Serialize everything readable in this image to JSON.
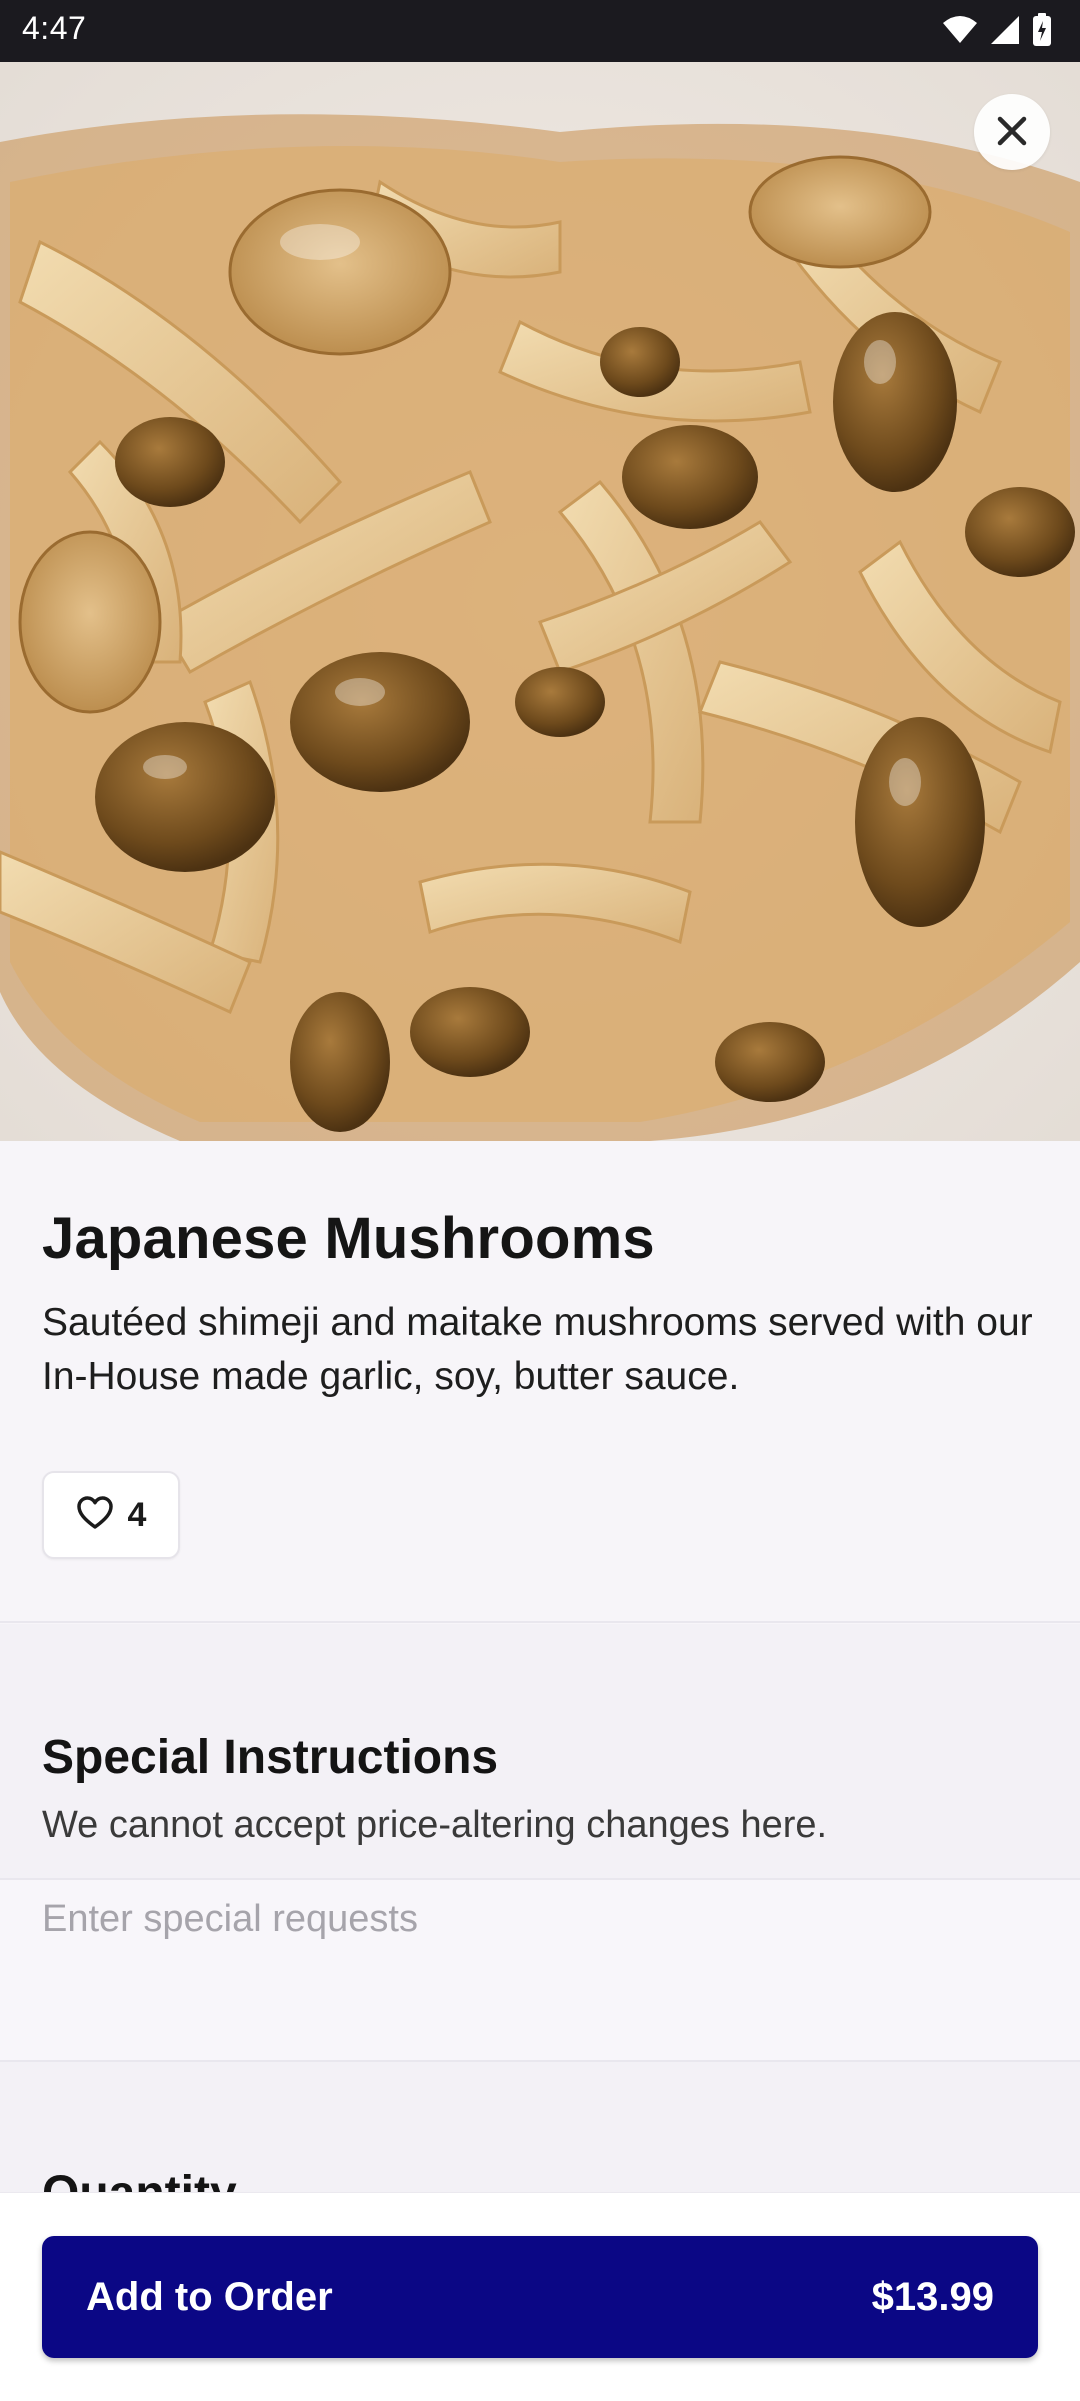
{
  "status_bar": {
    "time": "4:47",
    "icons": [
      "wifi-icon",
      "signal-icon",
      "battery-icon"
    ]
  },
  "hero": {
    "image": "mushrooms-photo",
    "close_icon": "close-icon"
  },
  "item": {
    "title": "Japanese Mushrooms",
    "description": "Sautéed shimeji and maitake mushrooms served with our In-House made garlic, soy, butter sauce.",
    "likes": "4",
    "like_icon": "heart-icon"
  },
  "special_instructions": {
    "title": "Special Instructions",
    "note": "We cannot accept price-altering changes here.",
    "placeholder": "Enter special requests",
    "value": ""
  },
  "quantity": {
    "title": "Quantity"
  },
  "footer": {
    "button_label": "Add to Order",
    "price": "$13.99",
    "button_color": "#0b0785"
  }
}
